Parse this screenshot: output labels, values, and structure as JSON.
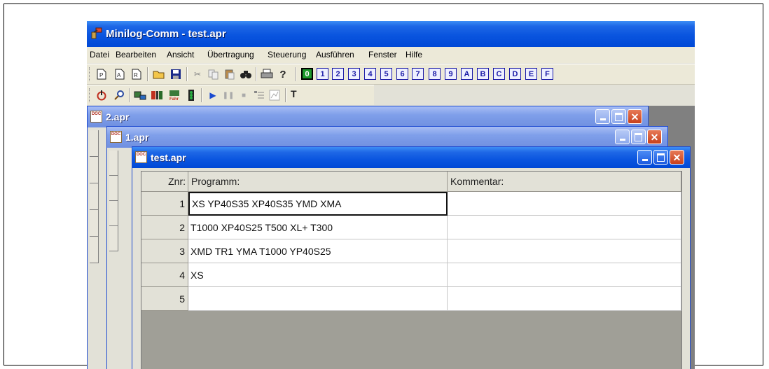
{
  "app": {
    "title": "Minilog-Comm - test.apr"
  },
  "menu": [
    "Datei",
    "Bearbeiten",
    "Ansicht",
    "Übertragung",
    "Steuerung",
    "Ausführen",
    "Fenster",
    "Hilfe"
  ],
  "toolbar1": {
    "file_buttons": [
      "new-p-icon",
      "new-a-icon",
      "new-r-icon",
      "open-folder-icon",
      "save-disk-icon",
      "cut-scissors-icon",
      "copy-icon",
      "paste-icon",
      "find-binoculars-icon",
      "print-icon",
      "help-question-icon"
    ],
    "number_buttons": [
      "0",
      "1",
      "2",
      "3",
      "4",
      "5",
      "6",
      "7",
      "8",
      "9",
      "A",
      "B",
      "C",
      "D",
      "E",
      "F"
    ],
    "active_number": "0"
  },
  "toolbar2": {
    "buttons": [
      "power-icon",
      "zoom-icon",
      "connect-icon",
      "transfer-icon",
      "fahr-icon",
      "traffic-light-icon",
      "play-icon",
      "pause-icon",
      "stop-icon",
      "list-icon",
      "chart-icon"
    ],
    "text_button": "T"
  },
  "windows": [
    {
      "title": "2.apr",
      "active": false
    },
    {
      "title": "1.apr",
      "active": false
    },
    {
      "title": "test.apr",
      "active": true
    }
  ],
  "grid": {
    "headers": {
      "znr": "Znr:",
      "programm": "Programm:",
      "kommentar": "Kommentar:"
    },
    "rows": [
      {
        "znr": "1",
        "programm": "XS YP40S35 XP40S35 YMD XMA",
        "kommentar": ""
      },
      {
        "znr": "2",
        "programm": "T1000 XP40S25 T500 XL+ T300",
        "kommentar": ""
      },
      {
        "znr": "3",
        "programm": "XMD TR1 YMA T1000 YP40S25",
        "kommentar": ""
      },
      {
        "znr": "4",
        "programm": "XS",
        "kommentar": ""
      },
      {
        "znr": "5",
        "programm": "",
        "kommentar": ""
      }
    ],
    "selected_row": 1
  },
  "colors": {
    "xp_title": "#0a55df",
    "inactive_title": "#7f9fea",
    "active_number_bg": "#1c9a2c",
    "number_fg": "#1a1aa6"
  }
}
